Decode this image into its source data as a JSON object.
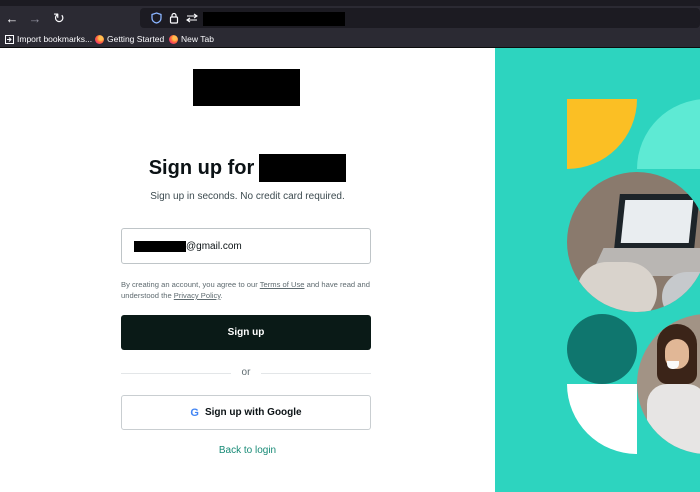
{
  "browser": {
    "nav": {
      "back_icon": "←",
      "forward_icon": "→",
      "reload_icon": "↻"
    },
    "urlbar": {
      "shield_icon": "shield-icon",
      "lock_icon": "lock-icon",
      "permissions_icon": "permissions-icon"
    },
    "bookmarks": [
      {
        "label": "Import bookmarks...",
        "icon": "import-icon"
      },
      {
        "label": "Getting Started",
        "icon": "firefox-icon"
      },
      {
        "label": "New Tab",
        "icon": "firefox-icon"
      }
    ]
  },
  "signup": {
    "heading": "Sign up for",
    "subheading": "Sign up in seconds. No credit card required.",
    "email_suffix": "@gmail.com",
    "consent_prefix": "By creating an account, you agree to our ",
    "terms_label": "Terms of Use",
    "consent_middle": " and have read and understood the ",
    "privacy_label": "Privacy Policy",
    "consent_suffix": ".",
    "signup_button": "Sign up",
    "or_label": "or",
    "google_button": "Sign up with Google",
    "google_icon_glyph": "G",
    "back_link": "Back to login"
  },
  "colors": {
    "accent": "#2dd4bf",
    "primary_button": "#0a1a17",
    "link": "#178a76",
    "yellow": "#fbbf24",
    "dark_teal": "#0f766e"
  }
}
